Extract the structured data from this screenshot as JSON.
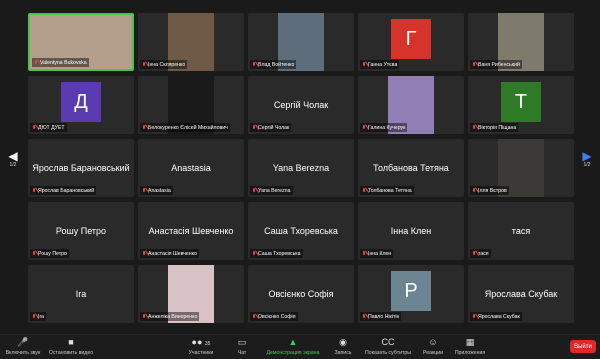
{
  "nav": {
    "prev_page": "1/2",
    "next_page": "1/2"
  },
  "tiles": [
    {
      "name": "Valentyna Bukovska",
      "kind": "video",
      "bg": "#b39f8c",
      "speaking": true
    },
    {
      "name": "Інна Скляренко",
      "kind": "video",
      "bg": "#6e5a46"
    },
    {
      "name": "Влад Войтенко",
      "kind": "video",
      "bg": "#5d6d7c"
    },
    {
      "name": "Ганна Утєва",
      "kind": "letter",
      "letter": "Г",
      "color": "#d6342a"
    },
    {
      "name": "Ваня Рибенський",
      "kind": "video",
      "bg": "#7e7a6c"
    },
    {
      "name": "ДЮТ ДУЕТ",
      "kind": "letter",
      "letter": "Д",
      "color": "#5b3bb0"
    },
    {
      "name": "Белокуренко Єлісей Михайлович",
      "kind": "video",
      "bg": "#1a1a1a"
    },
    {
      "name": "Сергій Чолак",
      "kind": "text",
      "big": "Сергій Чолак"
    },
    {
      "name": "Галина Кучерук",
      "kind": "video",
      "bg": "#8f7fb5"
    },
    {
      "name": "Вікторія Піщана",
      "kind": "letter",
      "letter": "Т",
      "color": "#2e7a26"
    },
    {
      "name": "Ярослав Барановський",
      "kind": "text",
      "big": "Ярослав Барановський"
    },
    {
      "name": "Anastasia",
      "kind": "text",
      "big": "Anastasia"
    },
    {
      "name": "Yana Berezna",
      "kind": "text",
      "big": "Yana Berezna"
    },
    {
      "name": "Толбанова Тетяна",
      "kind": "text",
      "big": "Толбанова Тетяна"
    },
    {
      "name": "Ілля Вєтров",
      "kind": "video",
      "bg": "#3b3a36"
    },
    {
      "name": "Рошу Петро",
      "kind": "text",
      "big": "Рошу Петро"
    },
    {
      "name": "Анастасія Шевченко",
      "kind": "text",
      "big": "Анастасія Шевченко"
    },
    {
      "name": "Саша Тхоревська",
      "kind": "text",
      "big": "Саша Тхоревська"
    },
    {
      "name": "Інна Клен",
      "kind": "text",
      "big": "Інна Клен"
    },
    {
      "name": "тася",
      "kind": "text",
      "big": "тася"
    },
    {
      "name": "Ira",
      "kind": "text",
      "big": "Ira"
    },
    {
      "name": "Анжеліка Виноренко",
      "kind": "video",
      "bg": "#d8c2c6"
    },
    {
      "name": "Овсієнко Софія",
      "kind": "text",
      "big": "Овсієнко Софія"
    },
    {
      "name": "Павло Нікітін",
      "kind": "letter",
      "letter": "P",
      "color": "#6d8593"
    },
    {
      "name": "Ярослава Скубак",
      "kind": "text",
      "big": "Ярослава Скубак"
    }
  ],
  "toolbar": {
    "unmute": "Включить звук",
    "stop_video": "Остановить видео",
    "participants": "Участники",
    "participants_count": "35",
    "chat": "Чат",
    "share": "Демонстрация экрана",
    "record": "Запись",
    "captions": "Показать субтитры",
    "reactions": "Реакции",
    "apps": "Приложения",
    "leave": "Выйти"
  }
}
